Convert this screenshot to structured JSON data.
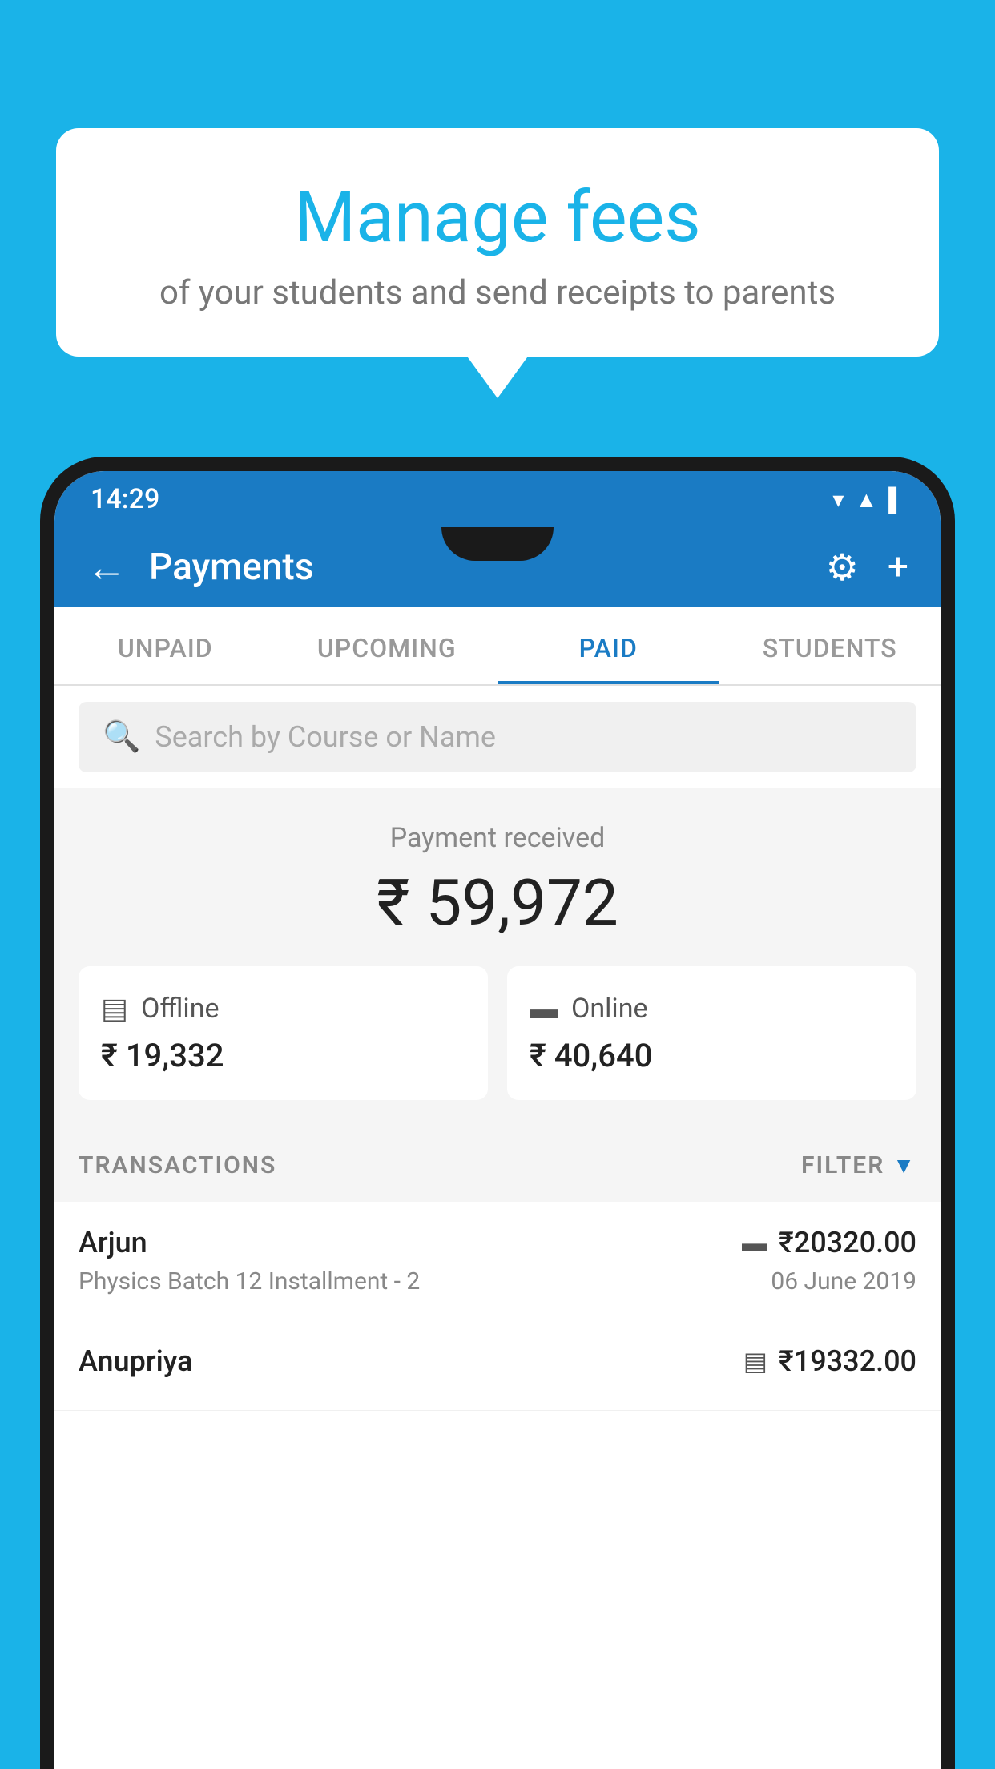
{
  "background_color": "#1ab3e8",
  "bubble": {
    "title": "Manage fees",
    "subtitle": "of your students and send receipts to parents"
  },
  "status_bar": {
    "time": "14:29",
    "icons": [
      "▼",
      "▲",
      "▌"
    ]
  },
  "header": {
    "title": "Payments",
    "back_label": "←",
    "settings_label": "⚙",
    "add_label": "+"
  },
  "tabs": [
    {
      "label": "UNPAID",
      "active": false
    },
    {
      "label": "UPCOMING",
      "active": false
    },
    {
      "label": "PAID",
      "active": true
    },
    {
      "label": "STUDENTS",
      "active": false
    }
  ],
  "search": {
    "placeholder": "Search by Course or Name"
  },
  "payment_summary": {
    "received_label": "Payment received",
    "total_amount": "₹ 59,972",
    "offline": {
      "label": "Offline",
      "amount": "₹ 19,332"
    },
    "online": {
      "label": "Online",
      "amount": "₹ 40,640"
    }
  },
  "transactions": {
    "header_label": "TRANSACTIONS",
    "filter_label": "FILTER",
    "items": [
      {
        "name": "Arjun",
        "amount": "₹20320.00",
        "course": "Physics Batch 12 Installment - 2",
        "date": "06 June 2019",
        "payment_type": "online"
      },
      {
        "name": "Anupriya",
        "amount": "₹19332.00",
        "course": "",
        "date": "",
        "payment_type": "offline"
      }
    ]
  }
}
